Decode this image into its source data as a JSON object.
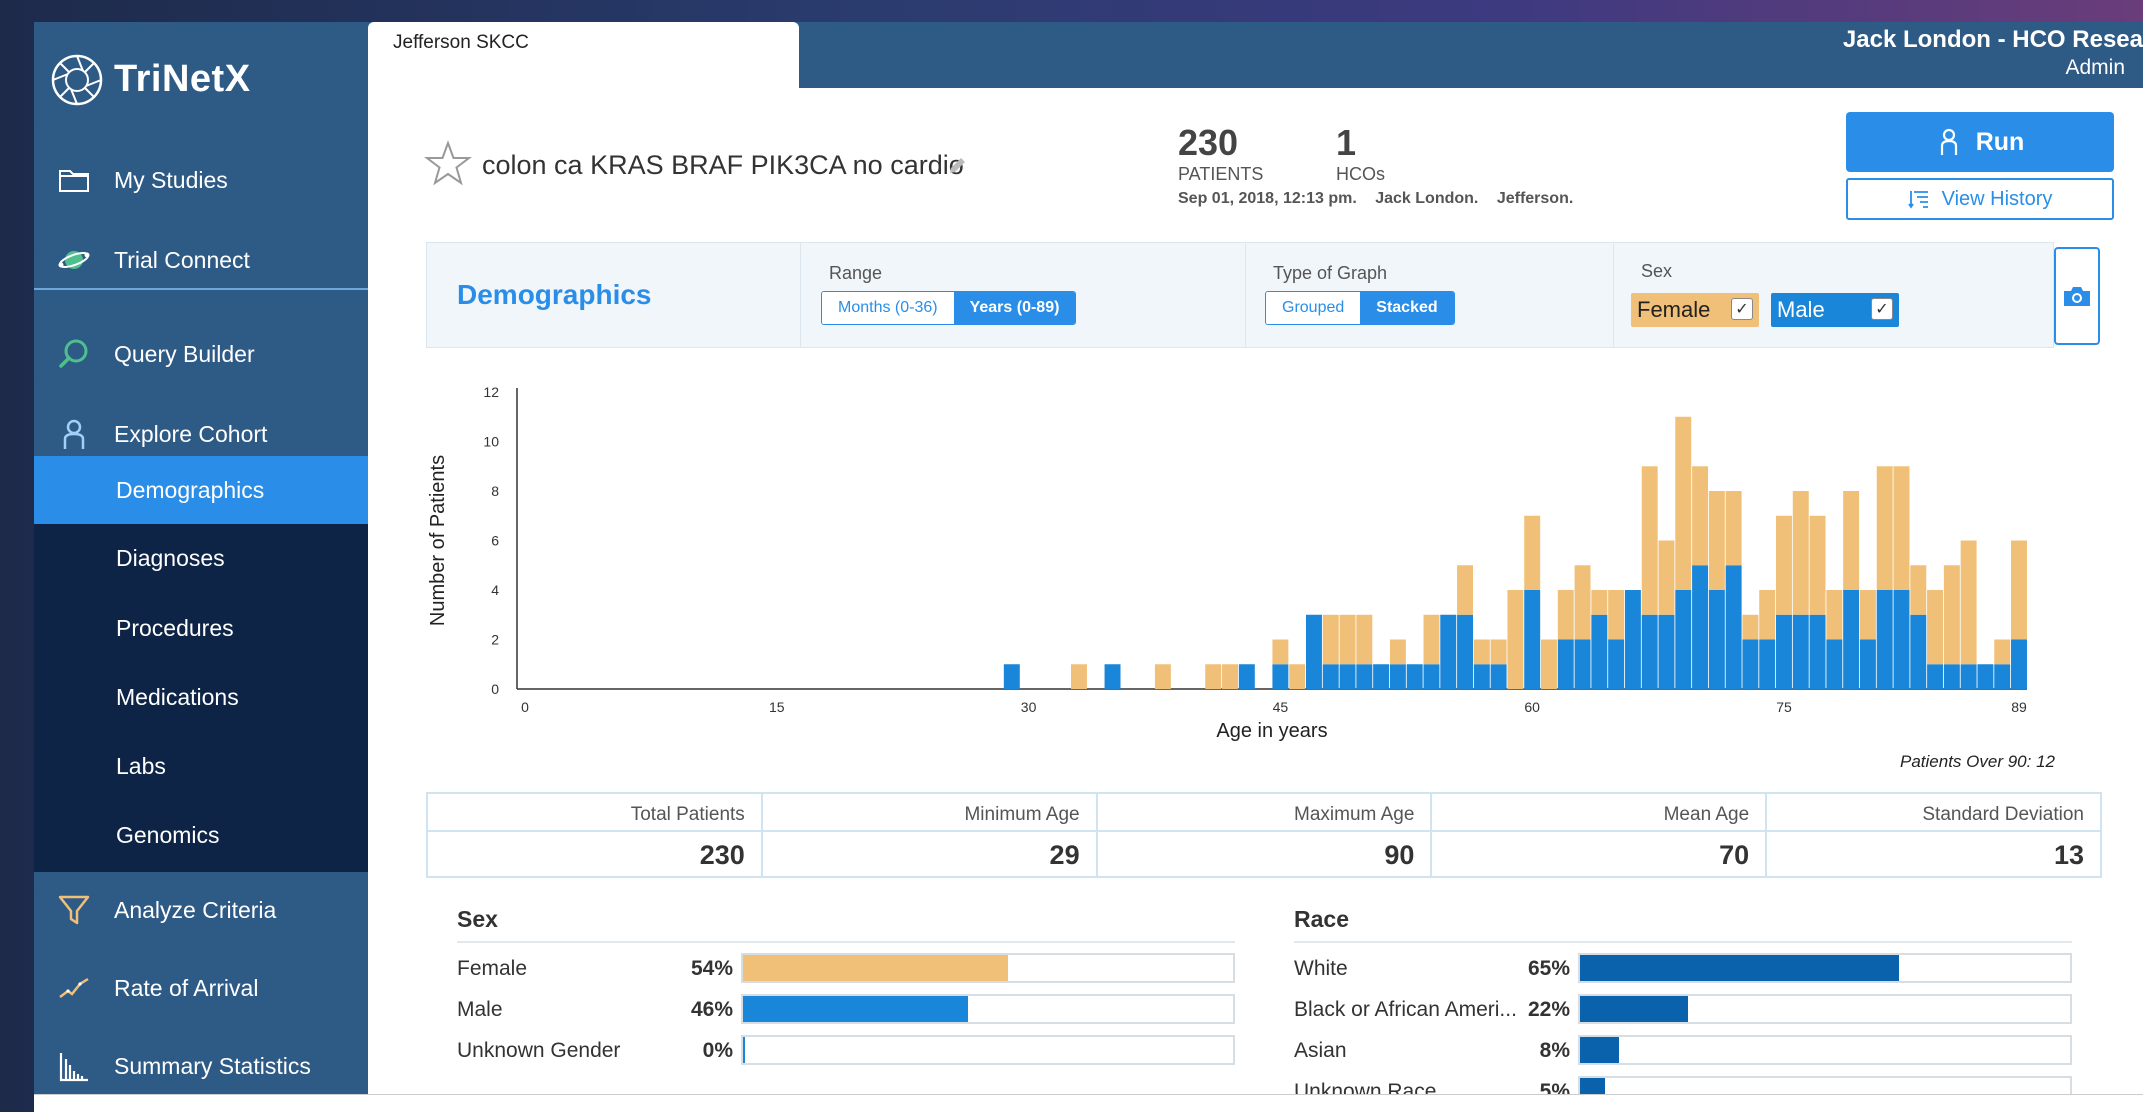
{
  "app": {
    "brand": "TriNetX"
  },
  "sidebar": {
    "items": [
      {
        "label": "My Studies",
        "icon": "folder-icon"
      },
      {
        "label": "Trial Connect",
        "icon": "globe-connect-icon"
      },
      {
        "label": "Query Builder",
        "icon": "search-icon"
      },
      {
        "label": "Explore Cohort",
        "icon": "person-icon"
      }
    ],
    "sub_items": [
      {
        "label": "Demographics",
        "active": true
      },
      {
        "label": "Diagnoses",
        "active": false
      },
      {
        "label": "Procedures",
        "active": false
      },
      {
        "label": "Medications",
        "active": false
      },
      {
        "label": "Labs",
        "active": false
      },
      {
        "label": "Genomics",
        "active": false
      }
    ],
    "bottom_items": [
      {
        "label": "Analyze Criteria",
        "icon": "funnel-icon"
      },
      {
        "label": "Rate of Arrival",
        "icon": "trend-icon"
      },
      {
        "label": "Summary Statistics",
        "icon": "bars-icon"
      }
    ]
  },
  "header": {
    "tab_label": "Jefferson SKCC",
    "user_name": "Jack London - HCO Resea",
    "user_role": "Admin"
  },
  "query": {
    "title": "colon ca KRAS BRAF PIK3CA no cardio",
    "patients_count": "230",
    "patients_label": "PATIENTS",
    "hcos_count": "1",
    "hcos_label": "HCOs",
    "meta_date": "Sep 01, 2018, 12:13 pm.",
    "meta_user": "Jack London.",
    "meta_org": "Jefferson.",
    "run_label": "Run",
    "history_label": "View History"
  },
  "controls": {
    "section_title": "Demographics",
    "range_label": "Range",
    "range_options": [
      "Months (0-36)",
      "Years (0-89)"
    ],
    "range_selected": "Years (0-89)",
    "graph_label": "Type of Graph",
    "graph_options": [
      "Grouped",
      "Stacked"
    ],
    "graph_selected": "Stacked",
    "sex_label": "Sex",
    "sex_female": "Female",
    "sex_male": "Male",
    "female_checked": true,
    "male_checked": true,
    "female_color": "#f0c078",
    "male_color": "#1a86d9"
  },
  "chart_data": {
    "type": "bar",
    "stacked": true,
    "xlabel": "Age in years",
    "ylabel": "Number of Patients",
    "ylim": [
      0,
      12
    ],
    "yticks": [
      0,
      2,
      4,
      6,
      8,
      10,
      12
    ],
    "xticks": [
      0,
      15,
      30,
      45,
      60,
      75,
      89
    ],
    "x_range": [
      0,
      89
    ],
    "series": [
      {
        "name": "Male",
        "color": "#1a86d9",
        "points": [
          [
            29,
            1
          ],
          [
            35,
            1
          ],
          [
            43,
            1
          ],
          [
            45,
            1
          ],
          [
            47,
            3
          ],
          [
            48,
            1
          ],
          [
            49,
            1
          ],
          [
            50,
            1
          ],
          [
            51,
            1
          ],
          [
            52,
            1
          ],
          [
            53,
            1
          ],
          [
            54,
            1
          ],
          [
            55,
            3
          ],
          [
            56,
            3
          ],
          [
            57,
            1
          ],
          [
            58,
            1
          ],
          [
            59,
            0
          ],
          [
            60,
            4
          ],
          [
            61,
            0
          ],
          [
            62,
            2
          ],
          [
            63,
            2
          ],
          [
            64,
            3
          ],
          [
            65,
            2
          ],
          [
            66,
            4
          ],
          [
            67,
            3
          ],
          [
            68,
            3
          ],
          [
            69,
            4
          ],
          [
            70,
            5
          ],
          [
            71,
            4
          ],
          [
            72,
            5
          ],
          [
            73,
            2
          ],
          [
            74,
            2
          ],
          [
            75,
            3
          ],
          [
            76,
            3
          ],
          [
            77,
            3
          ],
          [
            78,
            2
          ],
          [
            79,
            4
          ],
          [
            80,
            2
          ],
          [
            81,
            4
          ],
          [
            82,
            4
          ],
          [
            83,
            3
          ],
          [
            84,
            1
          ],
          [
            85,
            1
          ],
          [
            86,
            1
          ],
          [
            87,
            1
          ],
          [
            88,
            1
          ],
          [
            89,
            2
          ]
        ]
      },
      {
        "name": "Female",
        "color": "#f0c078",
        "points": [
          [
            33,
            1
          ],
          [
            38,
            1
          ],
          [
            41,
            1
          ],
          [
            42,
            1
          ],
          [
            44,
            0
          ],
          [
            45,
            1
          ],
          [
            46,
            1
          ],
          [
            48,
            2
          ],
          [
            49,
            2
          ],
          [
            50,
            2
          ],
          [
            52,
            1
          ],
          [
            54,
            2
          ],
          [
            56,
            2
          ],
          [
            57,
            1
          ],
          [
            58,
            1
          ],
          [
            59,
            4
          ],
          [
            60,
            3
          ],
          [
            61,
            2
          ],
          [
            62,
            2
          ],
          [
            63,
            3
          ],
          [
            64,
            1
          ],
          [
            65,
            2
          ],
          [
            66,
            0
          ],
          [
            67,
            6
          ],
          [
            68,
            3
          ],
          [
            69,
            7
          ],
          [
            70,
            4
          ],
          [
            71,
            4
          ],
          [
            72,
            3
          ],
          [
            73,
            1
          ],
          [
            74,
            2
          ],
          [
            75,
            4
          ],
          [
            76,
            5
          ],
          [
            77,
            4
          ],
          [
            78,
            2
          ],
          [
            79,
            4
          ],
          [
            80,
            2
          ],
          [
            81,
            5
          ],
          [
            82,
            5
          ],
          [
            83,
            2
          ],
          [
            84,
            3
          ],
          [
            85,
            4
          ],
          [
            86,
            5
          ],
          [
            88,
            1
          ],
          [
            89,
            4
          ]
        ]
      }
    ]
  },
  "over90": "Patients Over 90: 12",
  "stats": [
    {
      "label": "Total Patients",
      "value": "230"
    },
    {
      "label": "Minimum Age",
      "value": "29"
    },
    {
      "label": "Maximum Age",
      "value": "90"
    },
    {
      "label": "Mean Age",
      "value": "70"
    },
    {
      "label": "Standard Deviation",
      "value": "13"
    }
  ],
  "sex_breakdown": {
    "title": "Sex",
    "rows": [
      {
        "label": "Female",
        "pct": "54%",
        "fraction": 0.54,
        "color": "#f0c078"
      },
      {
        "label": "Male",
        "pct": "46%",
        "fraction": 0.46,
        "color": "#1a86d9"
      },
      {
        "label": "Unknown Gender",
        "pct": "0%",
        "fraction": 0.0,
        "color": "#1a86d9"
      }
    ]
  },
  "race_breakdown": {
    "title": "Race",
    "rows": [
      {
        "label": "White",
        "pct": "65%",
        "fraction": 0.65,
        "color": "#0a62ad"
      },
      {
        "label": "Black or African Ameri...",
        "pct": "22%",
        "fraction": 0.22,
        "color": "#0a62ad"
      },
      {
        "label": "Asian",
        "pct": "8%",
        "fraction": 0.08,
        "color": "#0a62ad"
      },
      {
        "label": "Unknown Race",
        "pct": "5%",
        "fraction": 0.05,
        "color": "#0a62ad"
      }
    ]
  }
}
